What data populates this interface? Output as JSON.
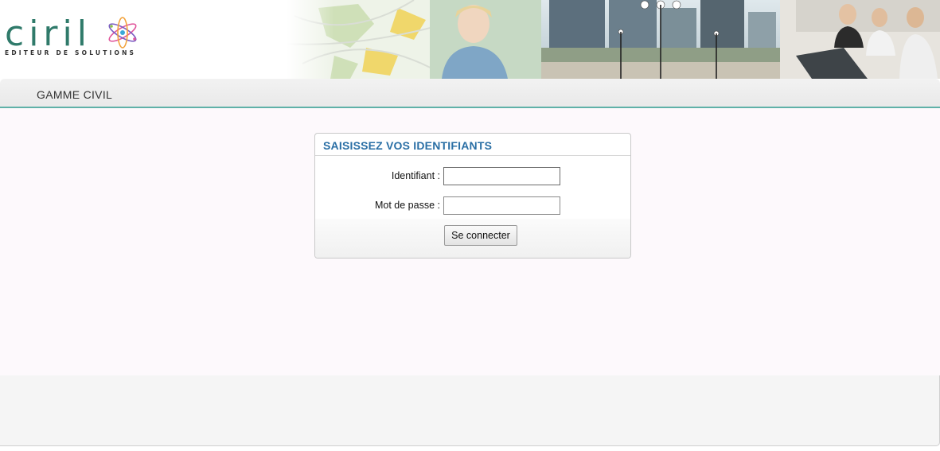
{
  "header": {
    "logo_text": "ciril",
    "logo_tagline": "EDITEUR DE SOLUTIONS"
  },
  "nav": {
    "label": "GAMME CIVIL"
  },
  "login": {
    "title": "SAISISSEZ VOS IDENTIFIANTS",
    "username_label": "Identifiant :",
    "username_value": "",
    "password_label": "Mot de passe :",
    "password_value": "",
    "submit_label": "Se connecter"
  },
  "colors": {
    "accent_teal": "#5fb1a8",
    "title_blue": "#2a6fa5",
    "logo_green": "#2f7a6a"
  }
}
